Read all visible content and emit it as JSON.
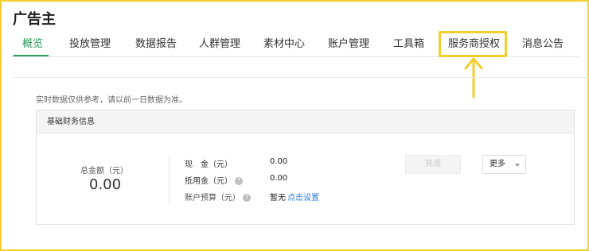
{
  "app": {
    "title": "广告主"
  },
  "tabs": [
    {
      "label": "概览",
      "active": true
    },
    {
      "label": "投放管理"
    },
    {
      "label": "数据报告"
    },
    {
      "label": "人群管理"
    },
    {
      "label": "素材中心"
    },
    {
      "label": "账户管理"
    },
    {
      "label": "工具箱"
    },
    {
      "label": "服务商授权",
      "highlighted": true
    },
    {
      "label": "消息公告"
    }
  ],
  "notice": "实时数据仅供参考，请以前一日数据为准。",
  "finance": {
    "header": "基础财务信息",
    "total_label": "总金额（元）",
    "total_value": "0.00",
    "rows": {
      "cash": {
        "label": "现　金（元）",
        "value": "0.00"
      },
      "credit": {
        "label": "抵用金（元）",
        "value": "0.00"
      },
      "budget": {
        "label": "账户预算（元）",
        "value": "暂无",
        "link": "点击设置"
      }
    },
    "recharge_button": "充值",
    "more_button": "更多"
  },
  "colors": {
    "accent": "#2e9b5e",
    "highlight": "#f2cf2f",
    "link": "#2f7ed8"
  }
}
